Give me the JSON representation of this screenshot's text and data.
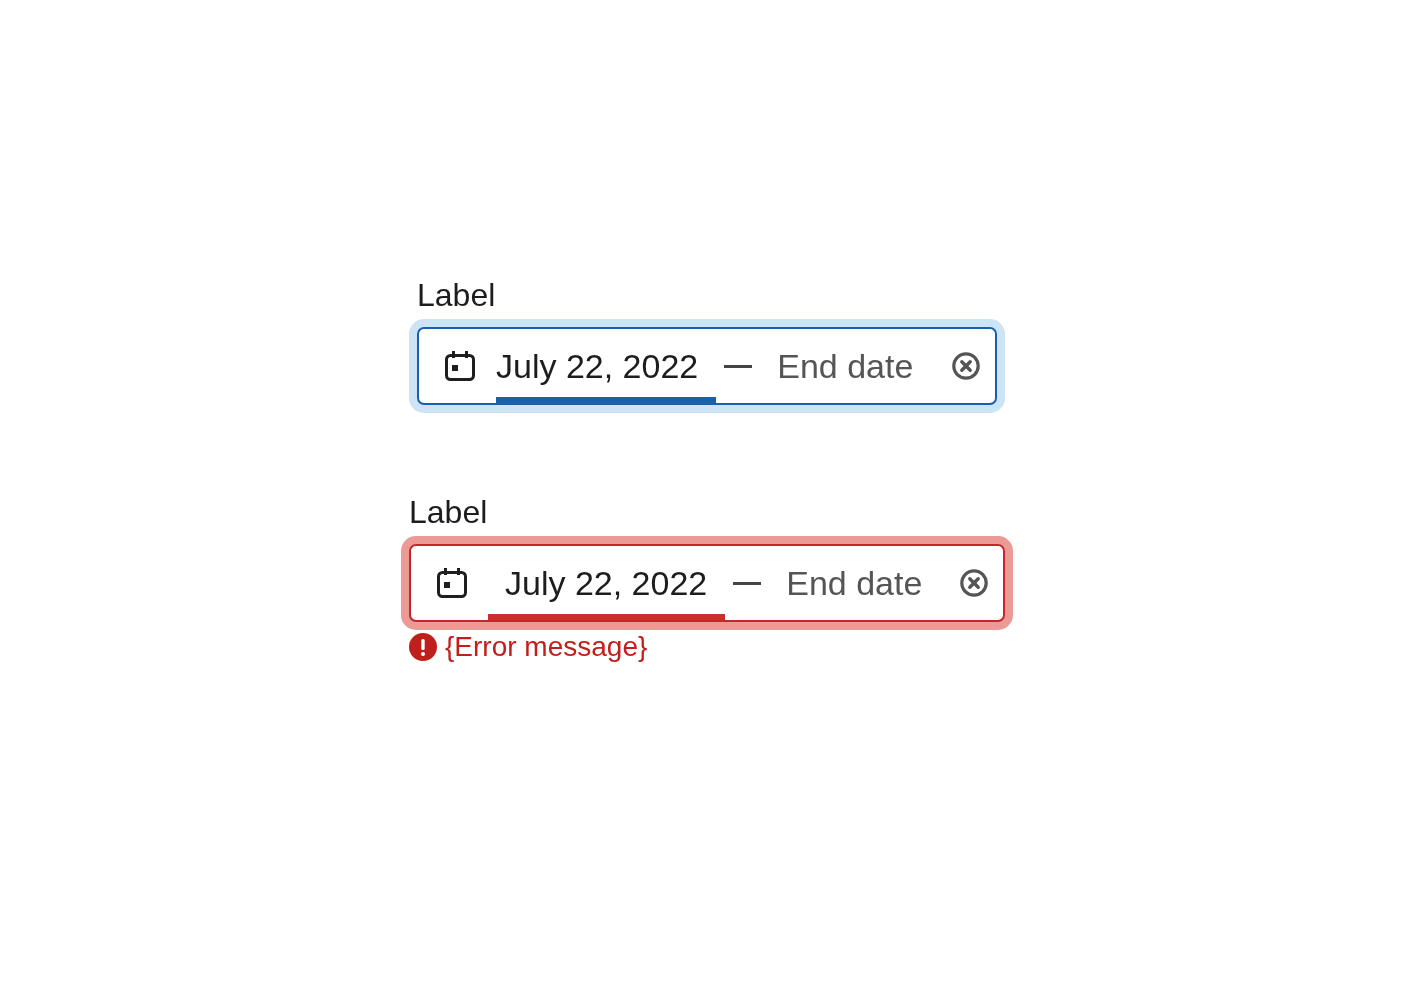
{
  "fields": [
    {
      "label": "Label",
      "focused": true,
      "invalid": false,
      "segments": [
        {
          "value": "July 22, 2022",
          "selected": true
        },
        {
          "placeholder": "End date",
          "selected": false
        }
      ]
    },
    {
      "label": "Label",
      "focused": true,
      "invalid": true,
      "segments": [
        {
          "value": "July 22, 2022",
          "selected": true
        },
        {
          "placeholder": "End date",
          "selected": false
        }
      ],
      "error_message": "{Error message}"
    }
  ]
}
